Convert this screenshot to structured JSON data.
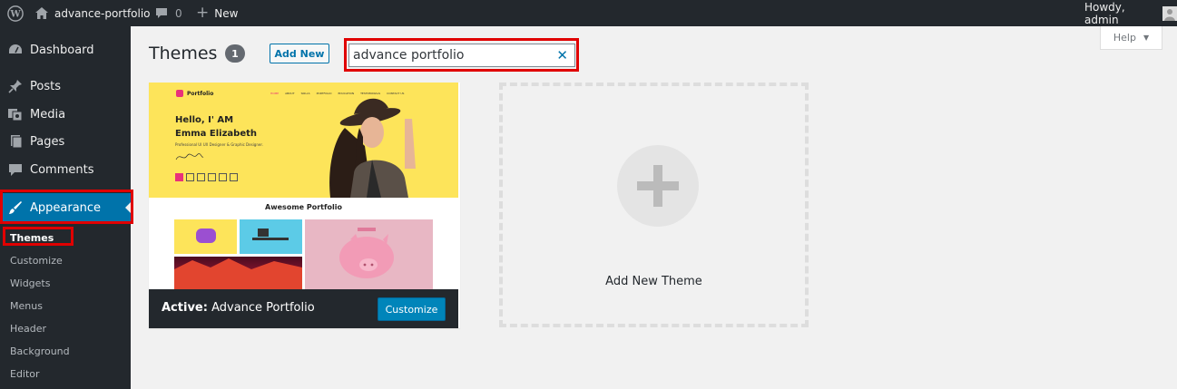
{
  "adminbar": {
    "site_name": "advance-portfolio",
    "comments_count": "0",
    "new_label": "New",
    "greeting": "Howdy, admin"
  },
  "sidebar": {
    "items": [
      {
        "label": "Dashboard",
        "icon": "dashboard-icon"
      },
      {
        "label": "Posts",
        "icon": "pin-icon"
      },
      {
        "label": "Media",
        "icon": "media-icon"
      },
      {
        "label": "Pages",
        "icon": "pages-icon"
      },
      {
        "label": "Comments",
        "icon": "comment-icon"
      },
      {
        "label": "Appearance",
        "icon": "brush-icon"
      }
    ],
    "submenu": [
      "Themes",
      "Customize",
      "Widgets",
      "Menus",
      "Header",
      "Background",
      "Editor"
    ]
  },
  "main": {
    "title": "Themes",
    "count": "1",
    "add_new_label": "Add New",
    "search": {
      "value": "advance portfolio"
    },
    "help_label": "Help"
  },
  "theme": {
    "active_prefix": "Active:",
    "name": "Advance Portfolio",
    "customize_label": "Customize",
    "preview": {
      "logo": "Portfolio",
      "nav": [
        "HOME",
        "ABOUT",
        "SKILLS",
        "PORTFOLIO",
        "EDUCATION",
        "TESTIMONIALS",
        "CONTACT US"
      ],
      "greeting": "Hello, I' AM",
      "person": "Emma Elizabeth",
      "tagline": "Professional UI UX Designer & Graphic Designer.",
      "section_title": "Awesome Portfolio"
    }
  },
  "add_theme": {
    "label": "Add New Theme"
  },
  "colors": {
    "accent": "#0073aa",
    "highlight": "#e00000",
    "hero": "#fde45a"
  }
}
